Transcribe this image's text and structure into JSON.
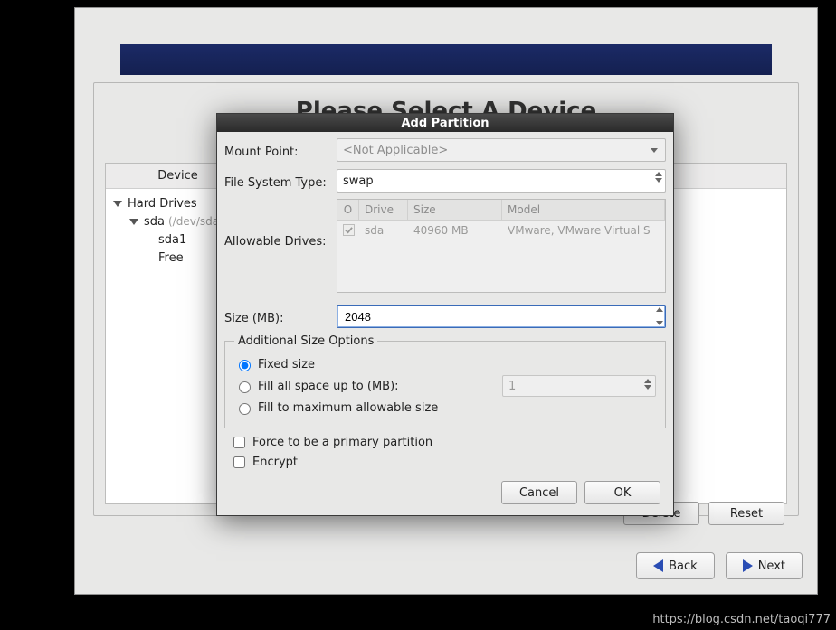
{
  "page": {
    "title": "Please Select A Device"
  },
  "device_table": {
    "header": "Device",
    "tree": {
      "root": "Hard Drives",
      "disk": "sda",
      "disk_path": "(/dev/sda)",
      "children": [
        "sda1",
        "Free"
      ]
    }
  },
  "buttons_bottom": {
    "delete": "Delete",
    "reset": "Reset"
  },
  "nav": {
    "back": "Back",
    "next": "Next"
  },
  "dialog": {
    "title": "Add Partition",
    "labels": {
      "mount_point": "Mount Point:",
      "fs_type": "File System Type:",
      "allowable": "Allowable Drives:",
      "size": "Size (MB):",
      "additional": "Additional Size Options",
      "fixed": "Fixed size",
      "fillup": "Fill all space up to (MB):",
      "fillmax": "Fill to maximum allowable size",
      "force_primary": "Force to be a primary partition",
      "encrypt": "Encrypt"
    },
    "values": {
      "mount_point": "<Not Applicable>",
      "fs_type": "swap",
      "size": "2048",
      "fillup_value": "1"
    },
    "drive_table": {
      "headers": {
        "chk": "O",
        "drive": "Drive",
        "size": "Size",
        "model": "Model"
      },
      "row": {
        "drive": "sda",
        "size": "40960 MB",
        "model": "VMware, VMware Virtual S"
      }
    },
    "buttons": {
      "cancel": "Cancel",
      "ok": "OK"
    }
  },
  "watermark": "https://blog.csdn.net/taoqi777"
}
